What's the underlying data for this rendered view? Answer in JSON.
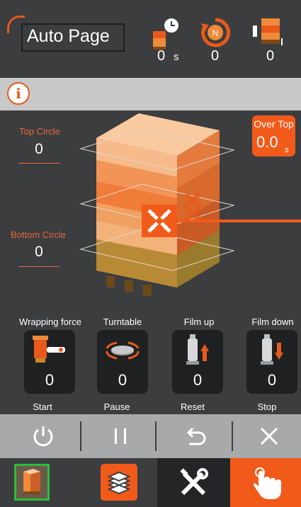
{
  "header": {
    "title": "Auto Page",
    "stats": [
      {
        "icon": "timer-box-icon",
        "value": "0",
        "unit": "s"
      },
      {
        "icon": "rotation-counter-icon",
        "value": "0",
        "unit": ""
      },
      {
        "icon": "pallet-count-icon",
        "value": "0",
        "unit": ""
      }
    ]
  },
  "info": {
    "icon": "info-icon",
    "symbol": "i"
  },
  "pallet": {
    "top_circle": {
      "label": "Top Circle",
      "value": "0"
    },
    "bottom_circle": {
      "label": "Bottom Circle",
      "value": "0"
    },
    "over_top": {
      "label": "Over Top",
      "value": "0.0",
      "unit": "s"
    }
  },
  "functions": [
    {
      "label": "Wrapping force",
      "value": "0",
      "icon": "wrapping-force-icon"
    },
    {
      "label": "Turntable",
      "value": "0",
      "icon": "turntable-icon"
    },
    {
      "label": "Film up",
      "value": "0",
      "icon": "film-up-icon"
    },
    {
      "label": "Film down",
      "value": "0",
      "icon": "film-down-icon"
    }
  ],
  "controls": [
    {
      "label": "Start",
      "icon": "power-icon"
    },
    {
      "label": "Pause",
      "icon": "pause-icon"
    },
    {
      "label": "Reset",
      "icon": "reset-icon"
    },
    {
      "label": "Stop",
      "icon": "close-icon"
    }
  ],
  "nav": [
    {
      "name": "auto",
      "icon": "pallet-icon",
      "active": true
    },
    {
      "name": "layers",
      "icon": "layers-icon",
      "active": false
    },
    {
      "name": "settings",
      "icon": "tools-icon",
      "active": false
    },
    {
      "name": "manual",
      "icon": "hand-touch-icon",
      "active": false
    }
  ],
  "colors": {
    "accent": "#f25a1a",
    "background": "#3b3d3f",
    "control_bar": "#a7a9ab",
    "info_bar": "#c8c8c8"
  }
}
